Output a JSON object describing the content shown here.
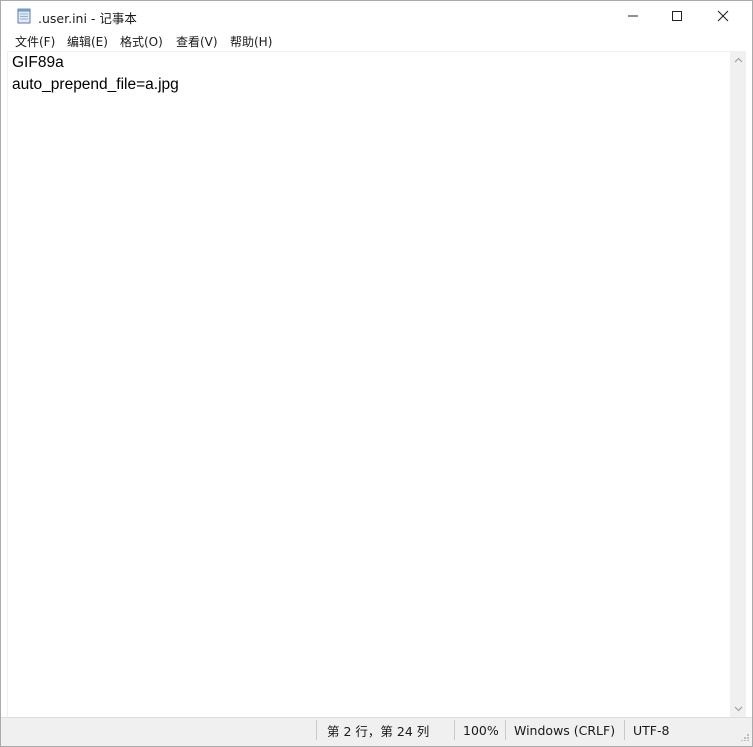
{
  "window": {
    "title": ".user.ini - 记事本",
    "controls": {
      "minimize": "minimize-icon",
      "maximize": "maximize-icon",
      "close": "close-icon"
    }
  },
  "menu": {
    "items": [
      {
        "label": "文件(F)"
      },
      {
        "label": "编辑(E)"
      },
      {
        "label": "格式(O)"
      },
      {
        "label": "查看(V)"
      },
      {
        "label": "帮助(H)"
      }
    ]
  },
  "editor": {
    "lines": [
      "GIF89a",
      "auto_prepend_file=a.jpg"
    ]
  },
  "status": {
    "position": "第 2 行，第 24 列",
    "zoom": "100%",
    "line_ending": "Windows (CRLF)",
    "encoding": "UTF-8"
  },
  "colors": {
    "accent": "#0078d7",
    "chrome": "#f0f0f0",
    "text": "#1a1a1a"
  }
}
